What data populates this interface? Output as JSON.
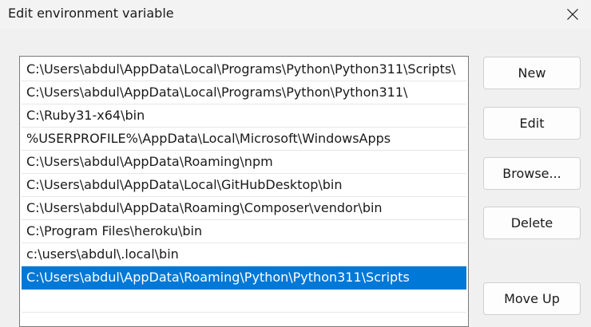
{
  "dialog": {
    "title": "Edit environment variable",
    "close_icon": "close-icon"
  },
  "path_entries": [
    {
      "value": "C:\\Users\\abdul\\AppData\\Local\\Programs\\Python\\Python311\\Scripts\\",
      "selected": false
    },
    {
      "value": "C:\\Users\\abdul\\AppData\\Local\\Programs\\Python\\Python311\\",
      "selected": false
    },
    {
      "value": "C:\\Ruby31-x64\\bin",
      "selected": false
    },
    {
      "value": "%USERPROFILE%\\AppData\\Local\\Microsoft\\WindowsApps",
      "selected": false
    },
    {
      "value": "C:\\Users\\abdul\\AppData\\Roaming\\npm",
      "selected": false
    },
    {
      "value": "C:\\Users\\abdul\\AppData\\Local\\GitHubDesktop\\bin",
      "selected": false
    },
    {
      "value": "C:\\Users\\abdul\\AppData\\Roaming\\Composer\\vendor\\bin",
      "selected": false
    },
    {
      "value": "C:\\Program Files\\heroku\\bin",
      "selected": false
    },
    {
      "value": "c:\\users\\abdul\\.local\\bin",
      "selected": false
    },
    {
      "value": "C:\\Users\\abdul\\AppData\\Roaming\\Python\\Python311\\Scripts",
      "selected": true
    },
    {
      "value": "",
      "selected": false
    }
  ],
  "buttons": {
    "new": "New",
    "edit": "Edit",
    "browse": "Browse...",
    "delete": "Delete",
    "move_up": "Move Up"
  },
  "colors": {
    "selection": "#0078d7",
    "background": "#f0f0f0"
  }
}
